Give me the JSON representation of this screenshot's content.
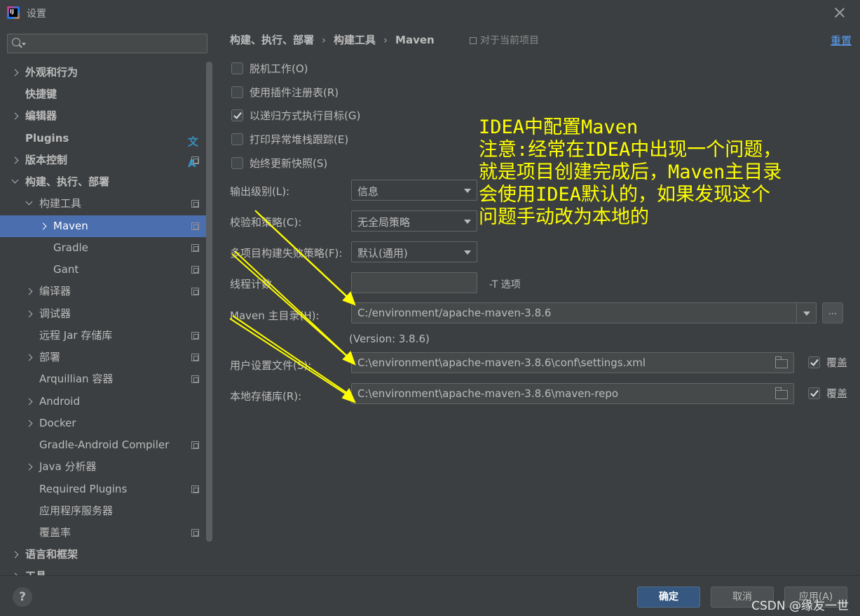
{
  "window": {
    "title": "设置"
  },
  "sidebar": {
    "search_placeholder": "",
    "items": [
      {
        "label": "外观和行为"
      },
      {
        "label": "快捷键"
      },
      {
        "label": "编辑器"
      },
      {
        "label": "Plugins"
      },
      {
        "label": "版本控制"
      },
      {
        "label": "构建、执行、部署"
      },
      {
        "label": "构建工具"
      },
      {
        "label": "Maven"
      },
      {
        "label": "Gradle"
      },
      {
        "label": "Gant"
      },
      {
        "label": "编译器"
      },
      {
        "label": "调试器"
      },
      {
        "label": "远程 Jar 存储库"
      },
      {
        "label": "部署"
      },
      {
        "label": "Arquillian 容器"
      },
      {
        "label": "Android"
      },
      {
        "label": "Docker"
      },
      {
        "label": "Gradle-Android Compiler"
      },
      {
        "label": "Java 分析器"
      },
      {
        "label": "Required Plugins"
      },
      {
        "label": "应用程序服务器"
      },
      {
        "label": "覆盖率"
      },
      {
        "label": "语言和框架"
      },
      {
        "label": "工具"
      }
    ]
  },
  "header": {
    "breadcrumb": [
      "构建、执行、部署",
      "构建工具",
      "Maven"
    ],
    "breadcrumb_sep": "›",
    "scope_label": "对于当前项目",
    "reset_label": "重置"
  },
  "options": {
    "offline": {
      "label": "脱机工作(O)",
      "checked": false
    },
    "plugin_registry": {
      "label": "使用插件注册表(R)",
      "checked": false
    },
    "recursive": {
      "label": "以递归方式执行目标(G)",
      "checked": true
    },
    "print_stack": {
      "label": "打印异常堆栈跟踪(E)",
      "checked": false
    },
    "always_update": {
      "label": "始终更新快照(S)",
      "checked": false
    }
  },
  "fields": {
    "output_level": {
      "label": "输出级别(L):",
      "value": "信息"
    },
    "checksum_policy": {
      "label": "校验和策略(C):",
      "value": "无全局策略"
    },
    "fail_policy": {
      "label": "多项目构建失败策略(F):",
      "value": "默认(通用)"
    },
    "thread_count": {
      "label": "线程计数",
      "value": "",
      "hint": "-T 选项"
    },
    "maven_home": {
      "label": "Maven 主目录(H):",
      "value": "C:/environment/apache-maven-3.8.6",
      "browse": "...",
      "version": "(Version: 3.8.6)"
    },
    "user_settings": {
      "label": "用户设置文件(S):",
      "value": "C:\\environment\\apache-maven-3.8.6\\conf\\settings.xml",
      "override_label": "覆盖",
      "override": true
    },
    "local_repo": {
      "label": "本地存储库(R):",
      "value": "C:\\environment\\apache-maven-3.8.6\\maven-repo",
      "override_label": "覆盖",
      "override": true
    }
  },
  "annotation": {
    "text": "IDEA中配置Maven\n注意:经常在IDEA中出现一个问题，\n就是项目创建完成后，Maven主目录\n会使用IDEA默认的，如果发现这个\n问题手动改为本地的",
    "color": "#ffff00"
  },
  "footer": {
    "help_label": "?",
    "ok_label": "确定",
    "cancel_label": "取消",
    "apply_label": "应用(A)",
    "watermark": "CSDN @缘友一世"
  },
  "colors": {
    "accent": "#4b6eaf",
    "link": "#589df6",
    "primary_button": "#365880"
  }
}
